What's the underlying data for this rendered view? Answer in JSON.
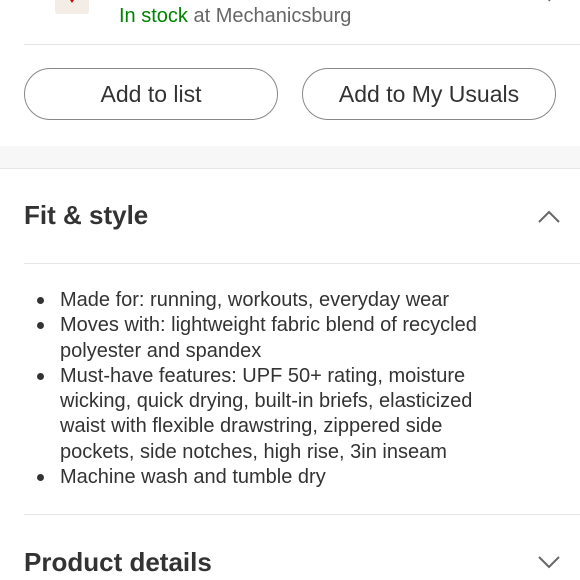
{
  "store": {
    "in_stock_label": "In stock",
    "location_text": "at Mechanicsburg",
    "icon": "store-pin-icon",
    "chevron": "chevron-right-icon"
  },
  "actions": {
    "add_to_list": "Add to list",
    "add_to_usuals": "Add to My Usuals"
  },
  "fit_style": {
    "title": "Fit & style",
    "expanded": true,
    "toggle_icon": "chevron-up-icon",
    "bullets": [
      "Made for: running, workouts, everyday wear",
      "Moves with: lightweight fabric blend of recycled polyester and spandex",
      "Must-have features: UPF 50+ rating, moisture wicking, quick drying, built-in briefs, elasticized waist with flexible drawstring, zippered side pockets, side notches, high rise, 3in inseam",
      "Machine wash and tumble dry"
    ]
  },
  "product_details": {
    "title": "Product details",
    "expanded": false,
    "toggle_icon": "chevron-down-icon"
  },
  "colors": {
    "in_stock": "#008300",
    "brand_red": "#cc0000",
    "text": "#333333",
    "muted": "#666666"
  }
}
